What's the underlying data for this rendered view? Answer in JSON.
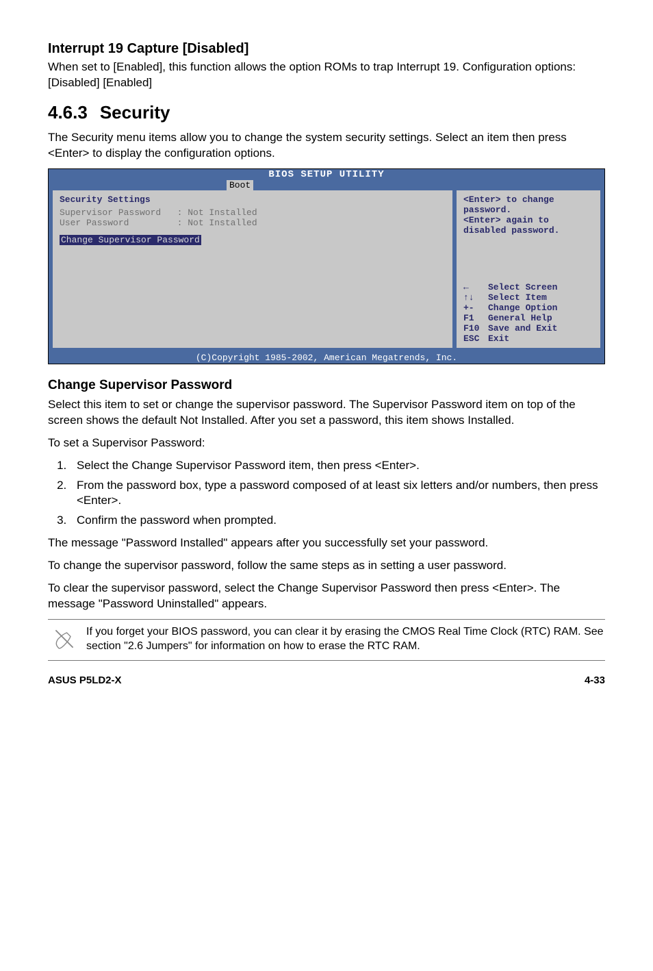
{
  "section1": {
    "title": "Interrupt 19 Capture [Disabled]",
    "body": "When set to [Enabled], this function allows the option ROMs to trap Interrupt 19. Configuration options: [Disabled] [Enabled]"
  },
  "section2": {
    "number": "4.6.3",
    "title": "Security",
    "body": "The Security menu items allow you to change the system security settings. Select an item then press <Enter> to display the configuration options."
  },
  "bios": {
    "title": "BIOS SETUP UTILITY",
    "tab": "Boot",
    "left": {
      "heading": "Security Settings",
      "line1": "Supervisor Password   : Not Installed",
      "line2": "User Password         : Not Installed",
      "sel": "Change Supervisor Password"
    },
    "right": {
      "help": "<Enter> to change password.\n<Enter> again to disabled password.",
      "keys": [
        {
          "k": "←",
          "d": "Select Screen"
        },
        {
          "k": "↑↓",
          "d": "Select Item"
        },
        {
          "k": "+-",
          "d": "Change Option"
        },
        {
          "k": "F1",
          "d": "General Help"
        },
        {
          "k": "F10",
          "d": "Save and Exit"
        },
        {
          "k": "ESC",
          "d": "Exit"
        }
      ]
    },
    "copyright": "(C)Copyright 1985-2002, American Megatrends, Inc."
  },
  "section3": {
    "title": "Change Supervisor Password",
    "p1": "Select this item to set or change the supervisor password. The Supervisor Password item on top of the screen shows the default Not Installed. After you set a password, this item shows Installed.",
    "p2": "To set a Supervisor Password:",
    "steps": [
      "Select the Change Supervisor Password item, then press <Enter>.",
      "From the password box, type a password composed of at least six letters and/or numbers, then press <Enter>.",
      "Confirm the password when prompted."
    ],
    "p3": "The message \"Password Installed\" appears after you successfully set your password.",
    "p4": "To change the supervisor password, follow the same steps as in setting a user password.",
    "p5": "To clear the supervisor password, select the Change Supervisor Password then press <Enter>. The message \"Password Uninstalled\" appears.",
    "note": "If you forget your BIOS password, you can clear it by erasing the CMOS Real Time Clock (RTC) RAM. See section \"2.6  Jumpers\" for information on how to erase the RTC RAM."
  },
  "footer": {
    "left": "ASUS P5LD2-X",
    "right": "4-33"
  }
}
